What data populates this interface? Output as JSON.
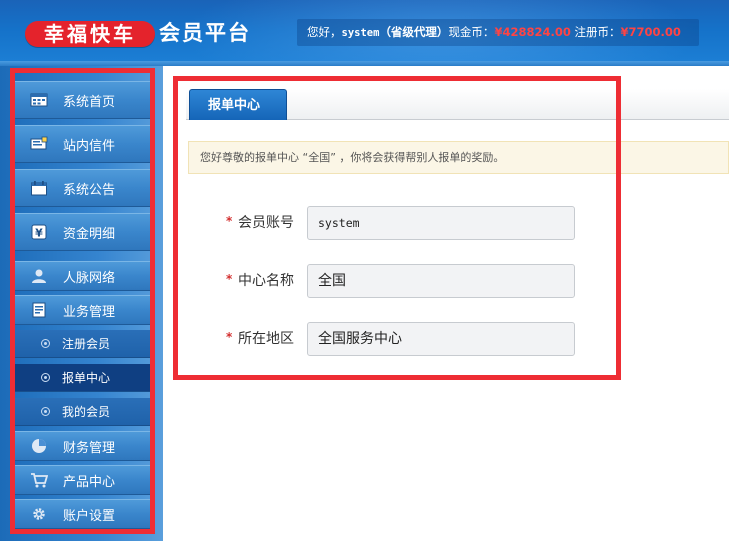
{
  "header": {
    "brand": "幸福快车",
    "platform": "会员平台",
    "greeting": "您好，",
    "username": "system",
    "role": "（省级代理）",
    "cash_label": "现金币：",
    "cash_value": "¥428824.00",
    "reg_label": "注册币：",
    "reg_value": "¥7700.00"
  },
  "sidebar": {
    "items": [
      {
        "label": "系统首页",
        "icon": "dashboard-icon"
      },
      {
        "label": "站内信件",
        "icon": "mail-icon"
      },
      {
        "label": "系统公告",
        "icon": "calendar-icon"
      },
      {
        "label": "资金明细",
        "icon": "money-icon"
      },
      {
        "label": "人脉网络",
        "icon": "user-icon"
      },
      {
        "label": "业务管理",
        "icon": "business-icon"
      }
    ],
    "sub_items": [
      {
        "label": "注册会员"
      },
      {
        "label": "报单中心"
      },
      {
        "label": "我的会员"
      }
    ],
    "bottom_items": [
      {
        "label": "财务管理",
        "icon": "pie-chart-icon"
      },
      {
        "label": "产品中心",
        "icon": "cart-icon"
      },
      {
        "label": "账户设置",
        "icon": "gear-icon"
      }
    ]
  },
  "main": {
    "tab_label": "报单中心",
    "notice": "您好尊敬的报单中心 “全国” ，你将会获得帮别人报单的奖励。",
    "fields": [
      {
        "label": "会员账号",
        "value": "system"
      },
      {
        "label": "中心名称",
        "value": "全国"
      },
      {
        "label": "所在地区",
        "value": "全国服务中心"
      }
    ]
  },
  "colors": {
    "brand_red": "#e4232c",
    "header_blue": "#1572c9",
    "money_red": "#ff4444",
    "highlight_red": "#ee2d34"
  }
}
